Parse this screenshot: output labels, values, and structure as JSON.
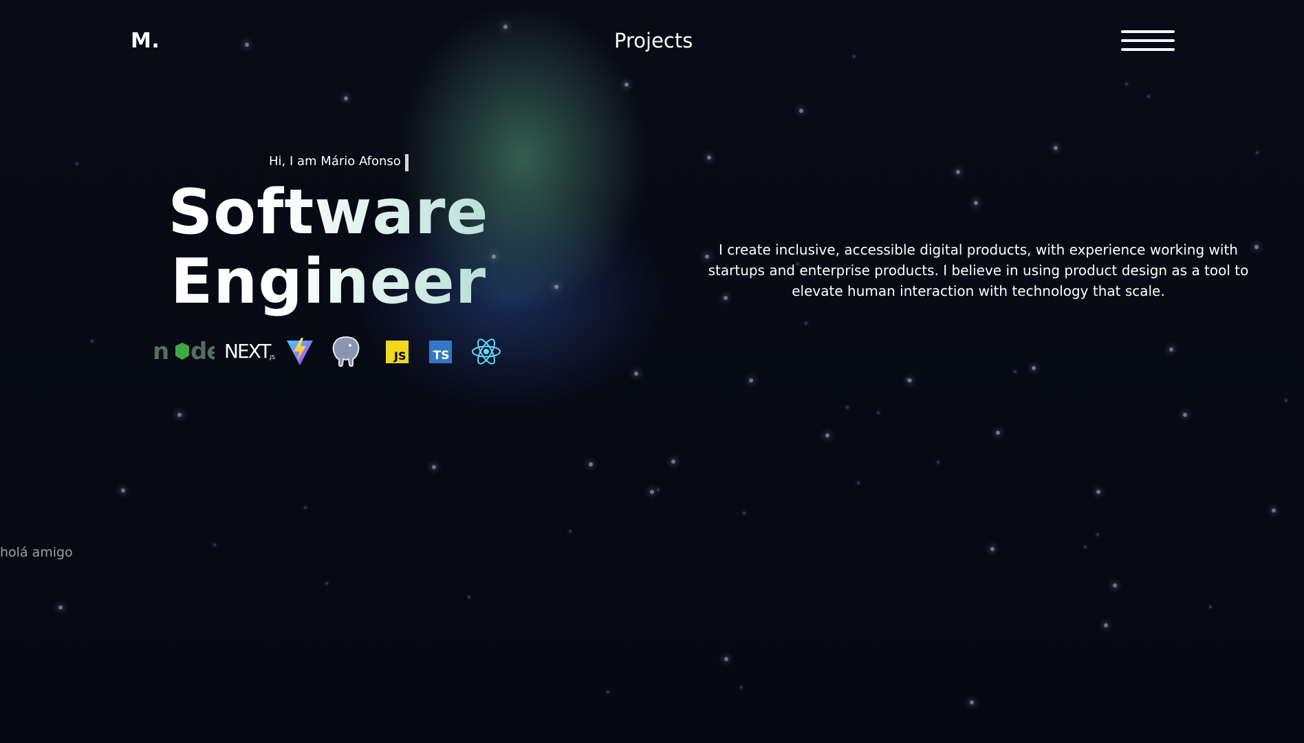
{
  "header": {
    "logo": "M.",
    "nav_label": "Projects",
    "menu_icon": "hamburger-menu-icon"
  },
  "hero": {
    "greeting": "Hi, I am Mário Afonso",
    "title_line1": "Software",
    "title_line2": "Engineer",
    "tech_stack": [
      {
        "name": "node-logo-icon",
        "label": "node"
      },
      {
        "name": "nextjs-logo-icon",
        "label": "NEXT.js"
      },
      {
        "name": "vite-logo-icon",
        "label": ""
      },
      {
        "name": "postgresql-logo-icon",
        "label": ""
      },
      {
        "name": "javascript-logo-icon",
        "label": "JS"
      },
      {
        "name": "typescript-logo-icon",
        "label": "TS"
      },
      {
        "name": "react-logo-icon",
        "label": ""
      }
    ]
  },
  "bio": {
    "text": "I create inclusive, accessible digital products, with experience working with startups and enterprise products. I believe in using product design as a tool to elevate human interaction with technology that scale."
  },
  "side_text": "holá amigo",
  "colors": {
    "background": "#070b16",
    "glow_green": "#52967a",
    "glow_blue": "#28468c",
    "js_yellow": "#f0d81d",
    "ts_blue": "#3178c6",
    "react_cyan": "#61dafb"
  }
}
